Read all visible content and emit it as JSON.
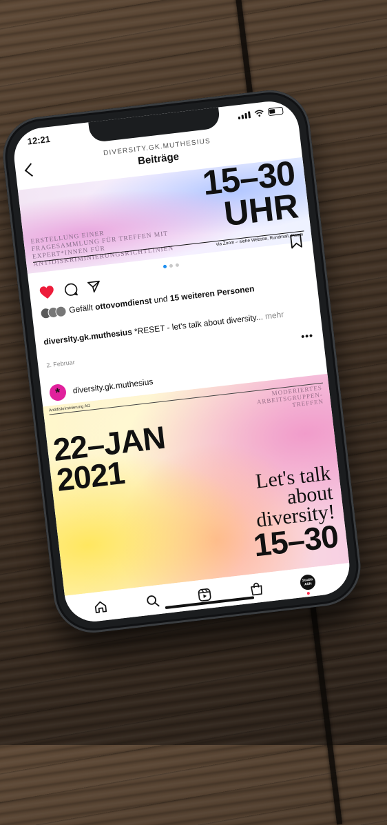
{
  "status": {
    "time": "12:21"
  },
  "header": {
    "account": "DIVERSITY.GK.MUTHESIUS",
    "title": "Beiträge"
  },
  "post1": {
    "time_line": "15–30",
    "uhr_line": "UHR",
    "description": "Erstellung einer Fragesammlung für Treffen mit Expert*innen für Antidiskriminierungsrichtlinien",
    "via": "via Zoom – siehe Website, Rundmail, Incom",
    "likes_prefix": "Gefällt ",
    "likes_user": "ottovomdienst",
    "likes_middle": " und ",
    "likes_others": "15 weiteren Personen",
    "caption_user": "diversity.gk.muthesius",
    "caption_text": " *RESET - let's talk about diversity...",
    "caption_more": " mehr",
    "date": "2. Februar"
  },
  "post2": {
    "username": "diversity.gk.muthesius",
    "avatar_glyph": "*",
    "ag_label": "Antidiskriminierung AG",
    "tag": "Moderiertes Arbeitsgruppen-treffen",
    "date_line1": "22–JAN",
    "date_line2": "2021",
    "talk_line1": "Let's talk",
    "talk_line2": "about",
    "talk_line3": "diversity!",
    "time": "15–30"
  },
  "tabbar": {
    "profile_label": "Studio ASH"
  },
  "colors": {
    "like_red": "#ed1c3a",
    "active_dot": "#1d8ff0",
    "avatar_magenta": "#e0219c"
  }
}
